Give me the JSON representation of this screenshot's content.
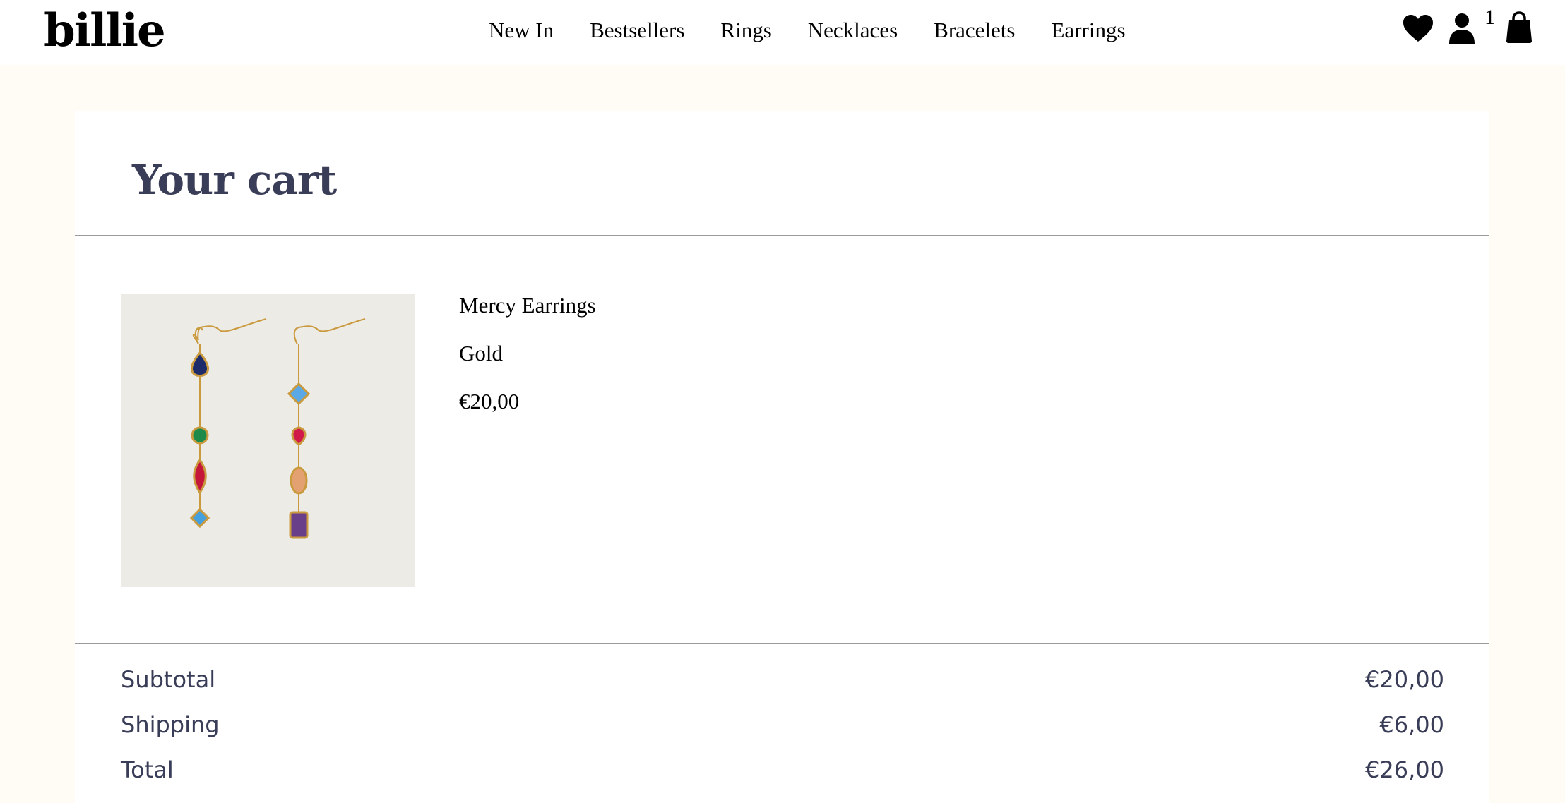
{
  "header": {
    "logo": "billie",
    "nav": [
      "New In",
      "Bestsellers",
      "Rings",
      "Necklaces",
      "Bracelets",
      "Earrings"
    ],
    "icons": [
      "heart-icon",
      "user-icon",
      "shopping-bag-icon"
    ],
    "cart_count": "1"
  },
  "cart": {
    "title": "Your cart",
    "items": [
      {
        "name": "Mercy Earrings",
        "variant": "Gold",
        "price": "€20,00"
      }
    ],
    "summary": {
      "subtotal_label": "Subtotal",
      "subtotal_value": "€20,00",
      "shipping_label": "Shipping",
      "shipping_value": "€6,00",
      "total_label": "Total",
      "total_value": "€26,00"
    }
  },
  "colors": {
    "page_background": "#fffbf5",
    "heading": "#3a3d57",
    "image_background": "#edebe6"
  }
}
